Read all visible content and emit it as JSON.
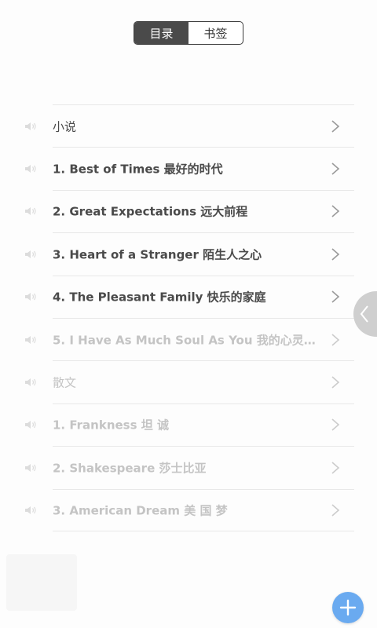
{
  "tabs": [
    {
      "label": "目录",
      "active": true
    },
    {
      "label": "书签",
      "active": false
    }
  ],
  "toc": [
    {
      "label": "小说",
      "bold": false,
      "faded": false
    },
    {
      "label": "1. Best of Times 最好的时代",
      "bold": true,
      "faded": false
    },
    {
      "label": "2. Great Expectations 远大前程",
      "bold": true,
      "faded": false
    },
    {
      "label": "3. Heart of a Stranger 陌生人之心",
      "bold": true,
      "faded": false
    },
    {
      "label": "4. The Pleasant Family 快乐的家庭",
      "bold": true,
      "faded": false
    },
    {
      "label": "5. I Have As Much Soul As You 我的心灵一...",
      "bold": true,
      "faded": true
    },
    {
      "label": "散文",
      "bold": false,
      "faded": true
    },
    {
      "label": "1. Frankness 坦 诚",
      "bold": true,
      "faded": true
    },
    {
      "label": "2. Shakespeare 莎士比亚",
      "bold": true,
      "faded": true
    },
    {
      "label": "3. American Dream 美 国 梦",
      "bold": true,
      "faded": true
    }
  ],
  "icons": {
    "speaker": "speaker-icon",
    "chevron": "chevron-right-icon",
    "side_tab": "chevron-left-icon",
    "fab": "plus-icon"
  },
  "colors": {
    "active_tab": "#4a4a4a",
    "fab": "#6aaaf0",
    "text": "#4a4a4a",
    "faded_text": "#c4c4c4"
  }
}
